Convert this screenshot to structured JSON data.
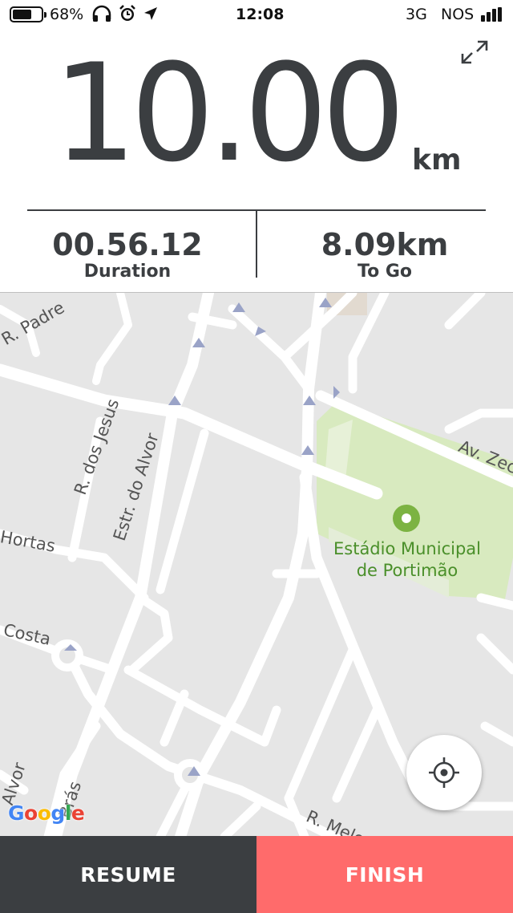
{
  "status_bar": {
    "battery_percent": "68%",
    "battery_level": 0.68,
    "time": "12:08",
    "network": "3G",
    "carrier": "NOS",
    "icons": [
      "headphones-icon",
      "alarm-icon",
      "location-arrow-icon"
    ]
  },
  "stats": {
    "distance": "10.00",
    "distance_unit": "km",
    "duration_value": "00.56.12",
    "duration_label": "Duration",
    "togo_value": "8.09km",
    "togo_label": "To Go"
  },
  "map": {
    "streets": {
      "padre": "R. Padre",
      "jesus": "R. dos Jesus",
      "alvor": "Estr. do Alvor",
      "hortas": "Hortas",
      "costa": "Costa",
      "zeca": "Av. Zeca",
      "bras": "Brás",
      "alvor2": "Alvor",
      "melo": "R. Melo"
    },
    "poi": {
      "name_line1": "Estádio Municipal",
      "name_line2": "de Portimão"
    },
    "attribution": "Google"
  },
  "colors": {
    "dark": "#3b3e41",
    "finish": "#ff6b6b",
    "park": "#d8eabf",
    "poi": "#7cb342"
  },
  "buttons": {
    "resume": "RESUME",
    "finish": "FINISH"
  }
}
